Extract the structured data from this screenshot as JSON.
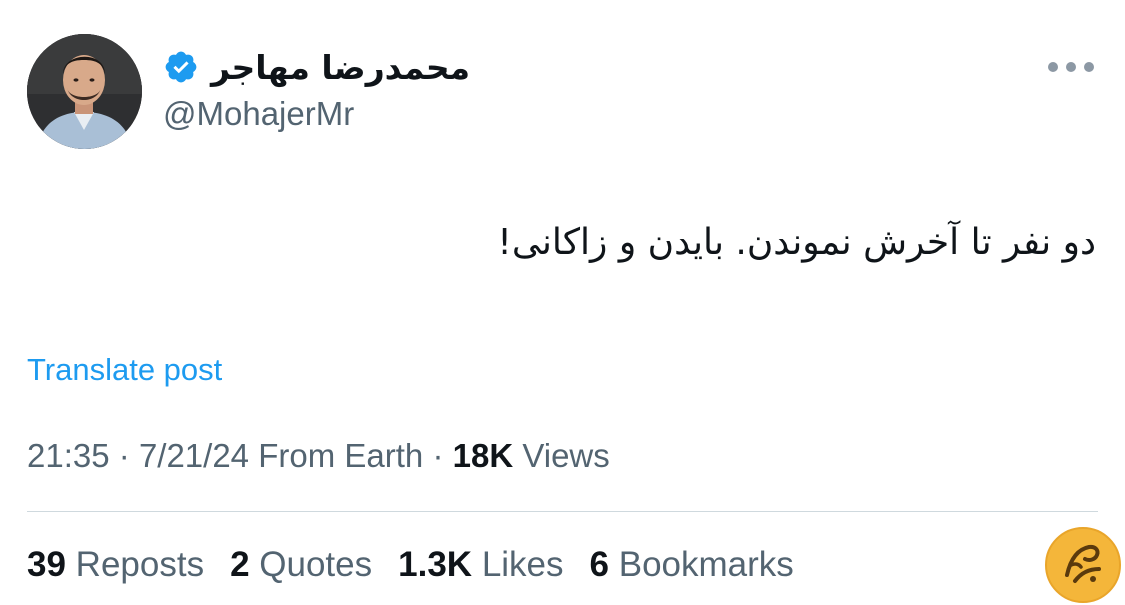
{
  "author": {
    "display_name": "محمدرضا مهاجر",
    "handle": "@MohajerMr",
    "verified": true
  },
  "tweet": {
    "text": "دو نفر تا آخرش نموندن. بایدن و زاکانی!",
    "translate_label": "Translate post"
  },
  "meta": {
    "time": "21:35",
    "separator": "·",
    "date": "7/21/24",
    "location": "From Earth",
    "views_count": "18K",
    "views_label": "Views"
  },
  "stats": {
    "reposts_count": "39",
    "reposts_label": "Reposts",
    "quotes_count": "2",
    "quotes_label": "Quotes",
    "likes_count": "1.3K",
    "likes_label": "Likes",
    "bookmarks_count": "6",
    "bookmarks_label": "Bookmarks"
  },
  "icons": {
    "verified": "verified-badge-icon",
    "more": "more-options-icon",
    "watermark": "watermark-logo"
  },
  "colors": {
    "accent": "#1d9bf0",
    "secondary_text": "#536471",
    "primary_text": "#0f1419",
    "divider": "#cfd9de",
    "watermark": "#f4b63a"
  }
}
